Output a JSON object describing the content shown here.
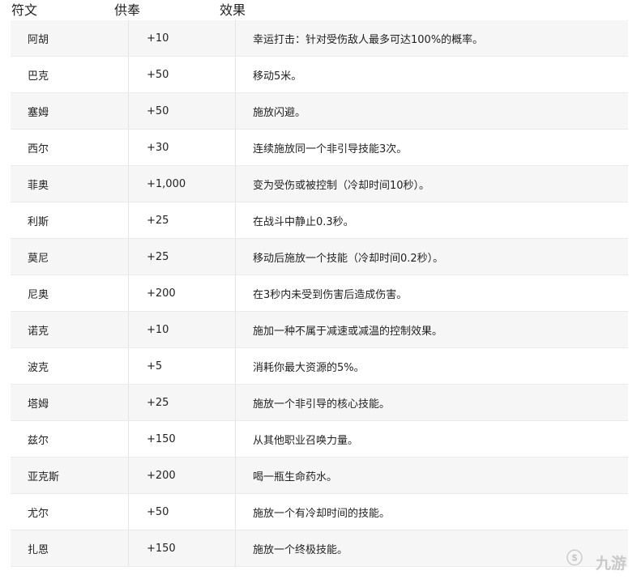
{
  "header": {
    "rune": "符文",
    "offering": "供奉",
    "effect": "效果"
  },
  "rows": [
    {
      "name": "阿胡",
      "offering": "+10",
      "effect": "幸运打击：针对受伤敌人最多可达100%的概率。"
    },
    {
      "name": "巴克",
      "offering": "+50",
      "effect": "移动5米。"
    },
    {
      "name": "塞姆",
      "offering": "+50",
      "effect": "施放闪避。"
    },
    {
      "name": "西尔",
      "offering": "+30",
      "effect": "连续施放同一个非引导技能3次。"
    },
    {
      "name": "菲奥",
      "offering": "+1,000",
      "effect": "变为受伤或被控制（冷却时间10秒）。"
    },
    {
      "name": "利斯",
      "offering": "+25",
      "effect": "在战斗中静止0.3秒。"
    },
    {
      "name": "莫尼",
      "offering": "+25",
      "effect": "移动后施放一个技能（冷却时间0.2秒）。"
    },
    {
      "name": "尼奥",
      "offering": "+200",
      "effect": "在3秒内未受到伤害后造成伤害。"
    },
    {
      "name": "诺克",
      "offering": "+10",
      "effect": "施加一种不属于减速或减温的控制效果。"
    },
    {
      "name": "波克",
      "offering": "+5",
      "effect": "消耗你最大资源的5%。"
    },
    {
      "name": "塔姆",
      "offering": "+25",
      "effect": "施放一个非引导的核心技能。"
    },
    {
      "name": "兹尔",
      "offering": "+150",
      "effect": "从其他职业召唤力量。"
    },
    {
      "name": "亚克斯",
      "offering": "+200",
      "effect": "喝一瓶生命药水。"
    },
    {
      "name": "尤尔",
      "offering": "+50",
      "effect": "施放一个有冷却时间的技能。"
    },
    {
      "name": "扎恩",
      "offering": "+150",
      "effect": "施放一个终极技能。"
    }
  ],
  "watermark": {
    "mark": "ⓢ",
    "text": "九游"
  }
}
